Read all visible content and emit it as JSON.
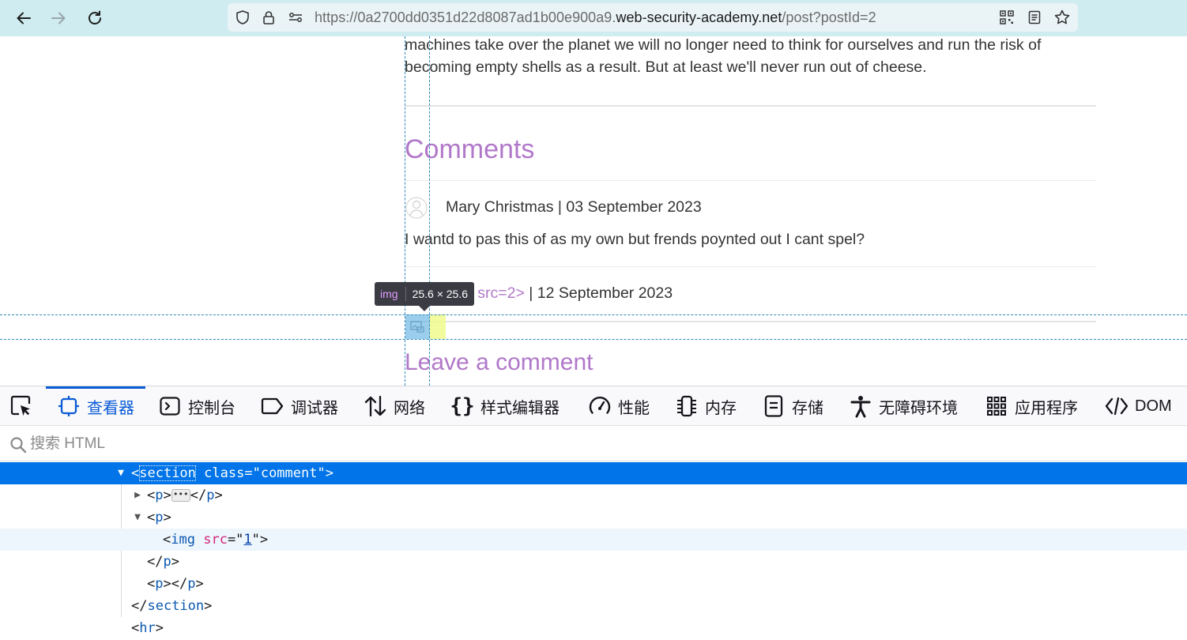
{
  "browser": {
    "url_prefix": "https://0a2700dd0351d22d8087ad1b00e900a9.",
    "url_domain": "web-security-academy.net",
    "url_path": "/post?postId=2"
  },
  "page": {
    "body_line1": "machines take over the planet we will no longer need to think for ourselves and run the risk of",
    "body_line2": "becoming empty shells as a result. But at least we'll never run out of cheese.",
    "comments_heading": "Comments",
    "comments": [
      {
        "author_date": "Mary Christmas | 03 September 2023",
        "text": "I wantd to pas this of as my own but frends poynted out I cant spel?"
      },
      {
        "author_fragment": "g src=2>",
        "date": " | 12 September 2023"
      }
    ],
    "leave_comment_heading": "Leave a comment"
  },
  "inspector_tooltip": {
    "tag": "img",
    "dims": "25.6 × 25.6"
  },
  "devtools": {
    "tabs": [
      {
        "label": "查看器",
        "icon": "inspector-icon",
        "active": true
      },
      {
        "label": "控制台",
        "icon": "console-icon"
      },
      {
        "label": "调试器",
        "icon": "debugger-icon"
      },
      {
        "label": "网络",
        "icon": "network-icon"
      },
      {
        "label": "样式编辑器",
        "icon": "style-editor-icon"
      },
      {
        "label": "性能",
        "icon": "performance-icon"
      },
      {
        "label": "内存",
        "icon": "memory-icon"
      },
      {
        "label": "存储",
        "icon": "storage-icon"
      },
      {
        "label": "无障碍环境",
        "icon": "accessibility-icon"
      },
      {
        "label": "应用程序",
        "icon": "application-icon"
      },
      {
        "label": "DOM",
        "icon": "dom-icon"
      }
    ],
    "search_placeholder": "搜索 HTML",
    "tree": {
      "section_tag": "section",
      "section_attr": "class",
      "section_val": "comment",
      "p_tag": "p",
      "img_tag": "img",
      "img_attr": "src",
      "img_val": "1",
      "section_close": "section",
      "hr_tag": "hr"
    }
  },
  "colors": {
    "toolbar_bg": "#cfecf1",
    "link_purple": "#b178c9",
    "devtools_accent": "#0a5bd5",
    "selected_row": "#0074e8"
  }
}
